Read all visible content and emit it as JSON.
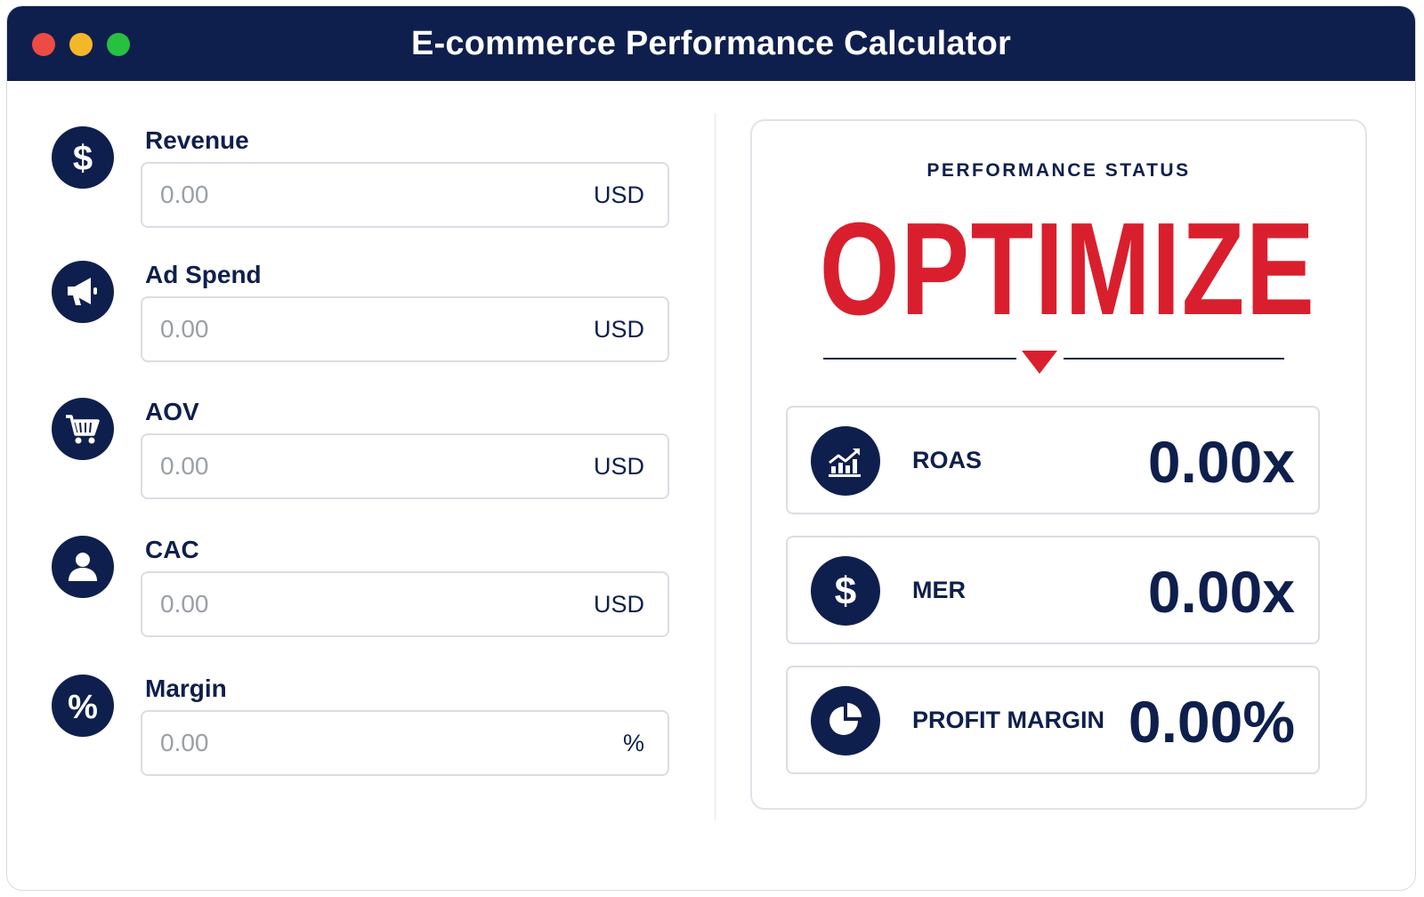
{
  "window": {
    "title": "E-commerce Performance Calculator"
  },
  "fields": [
    {
      "label": "Revenue",
      "placeholder": "0.00",
      "unit": "USD",
      "icon": "dollar-icon"
    },
    {
      "label": "Ad Spend",
      "placeholder": "0.00",
      "unit": "USD",
      "icon": "megaphone-icon"
    },
    {
      "label": "AOV",
      "placeholder": "0.00",
      "unit": "USD",
      "icon": "cart-icon"
    },
    {
      "label": "CAC",
      "placeholder": "0.00",
      "unit": "USD",
      "icon": "user-icon"
    },
    {
      "label": "Margin",
      "placeholder": "0.00",
      "unit": "%",
      "icon": "percent-icon"
    }
  ],
  "status": {
    "label": "PERFORMANCE STATUS",
    "value": "OPTIMIZE"
  },
  "metrics": [
    {
      "label": "ROAS",
      "value": "0.00x",
      "icon": "trend-chart-icon"
    },
    {
      "label": "MER",
      "value": "0.00x",
      "icon": "dollar-icon"
    },
    {
      "label": "PROFIT MARGIN",
      "value": "0.00%",
      "icon": "pie-chart-icon"
    }
  ],
  "colors": {
    "navy": "#0f1f4d",
    "accent_red": "#d91f2d",
    "border": "#dadde3",
    "placeholder": "#9aa0a8"
  }
}
